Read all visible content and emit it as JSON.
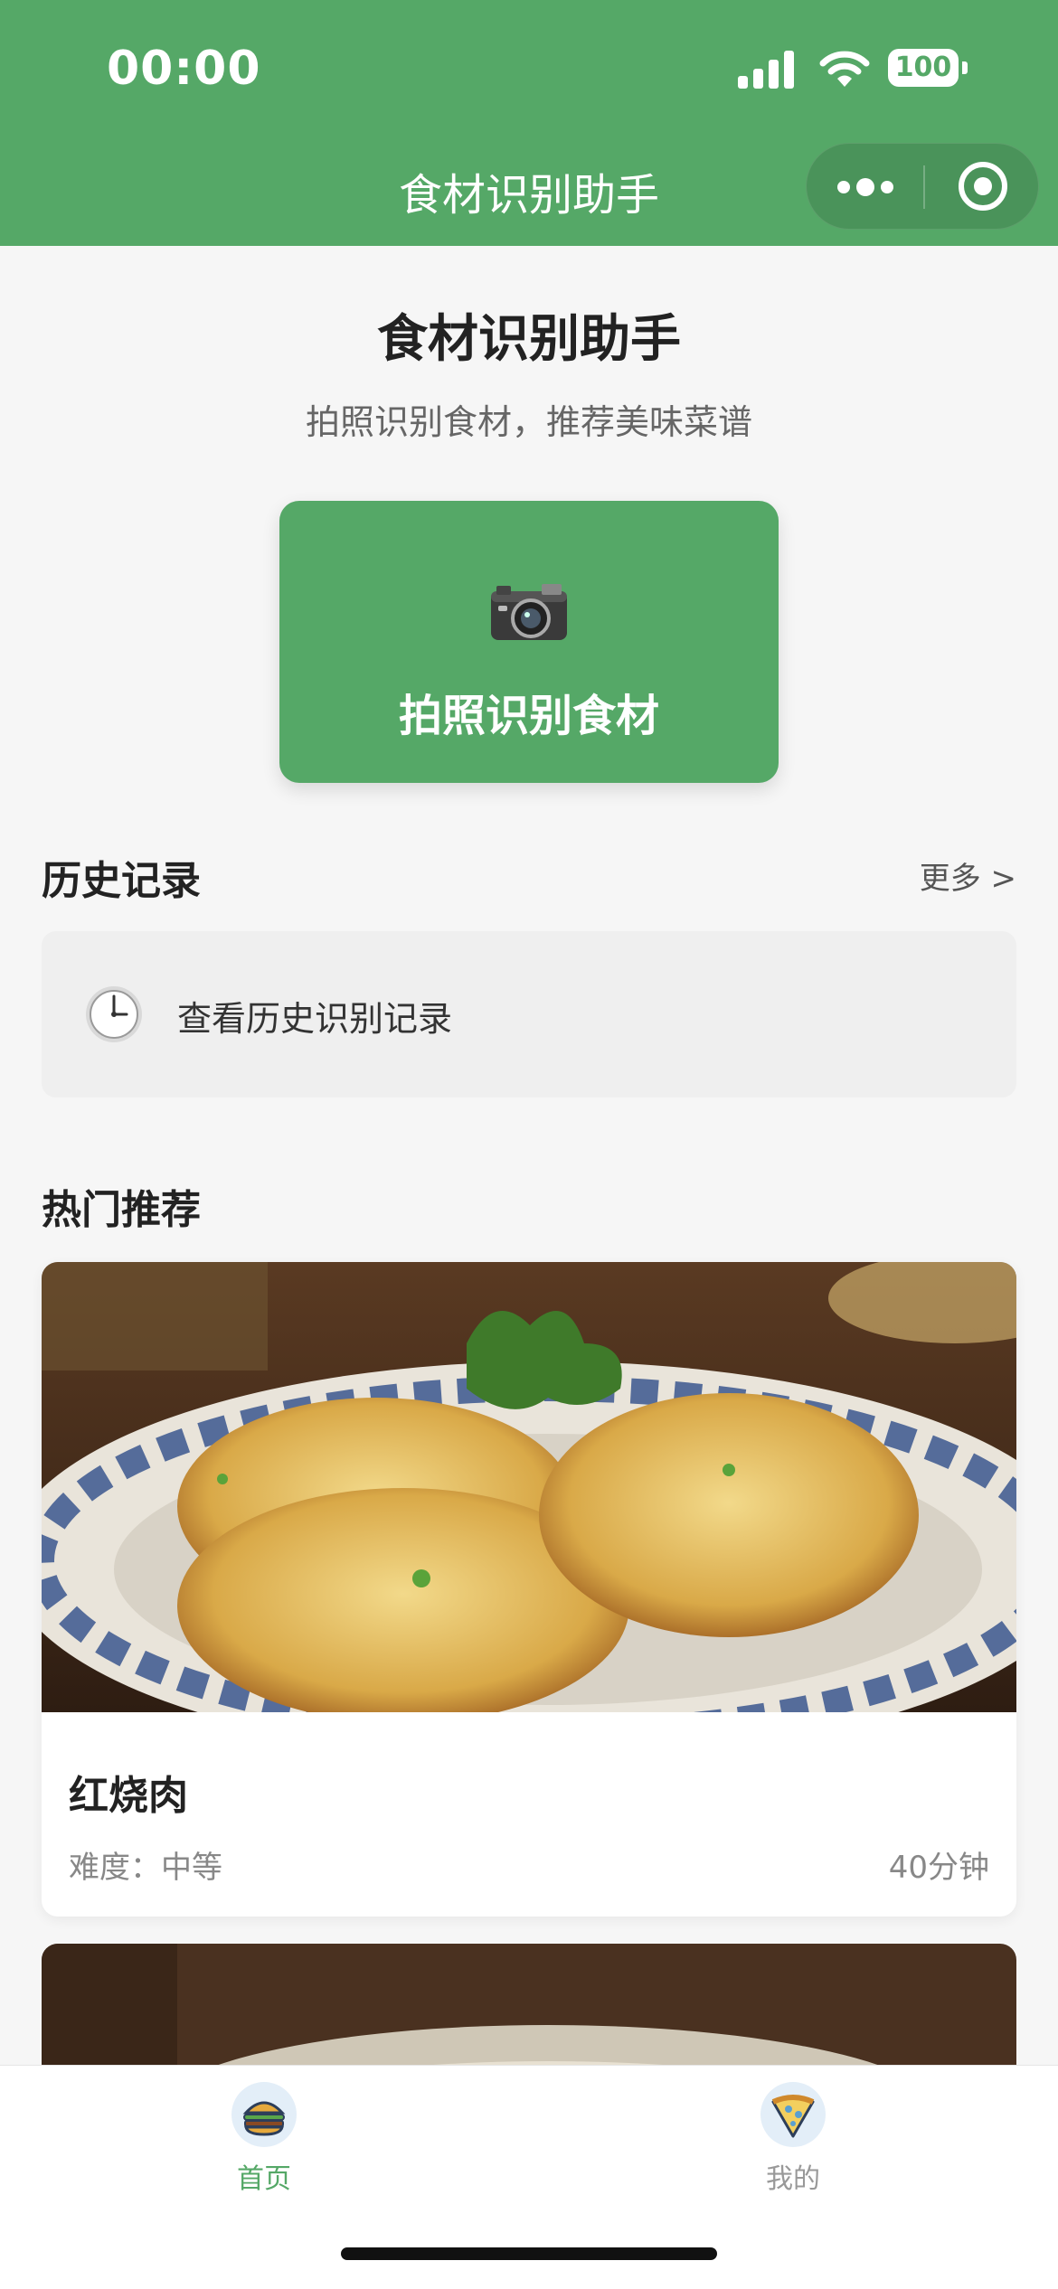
{
  "status_bar": {
    "time": "00:00",
    "battery": "100"
  },
  "nav": {
    "title": "食材识别助手"
  },
  "hero": {
    "title": "食材识别助手",
    "subtitle": "拍照识别食材，推荐美味菜谱",
    "camera_button_label": "拍照识别食材"
  },
  "history": {
    "title": "历史记录",
    "more": "更多 >",
    "entry_text": "查看历史识别记录"
  },
  "popular": {
    "title": "热门推荐",
    "recipes": [
      {
        "name": "红烧肉",
        "difficulty": "难度：中等",
        "time": "40分钟"
      }
    ]
  },
  "tabbar": {
    "tabs": [
      {
        "label": "首页",
        "icon": "burger-icon",
        "active": true
      },
      {
        "label": "我的",
        "icon": "pizza-icon",
        "active": false
      }
    ]
  },
  "colors": {
    "accent": "#55a867",
    "background": "#f6f6f6"
  }
}
